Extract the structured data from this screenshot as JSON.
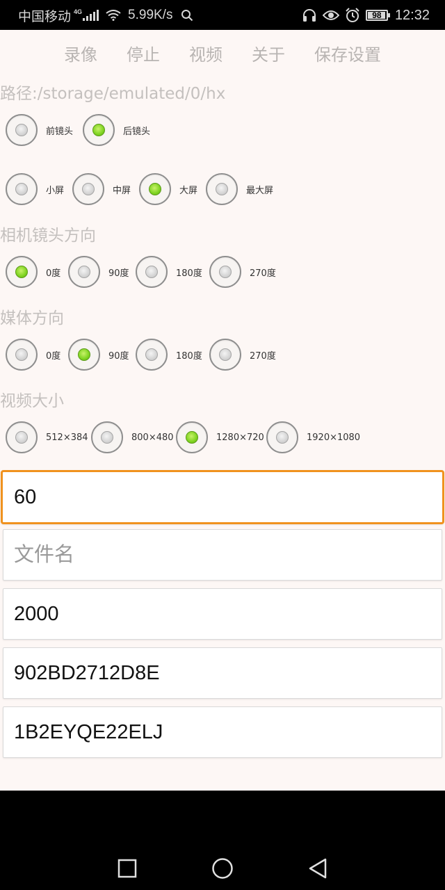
{
  "status_bar": {
    "carrier": "中国移动",
    "network_type": "4G",
    "speed": "5.99K/s",
    "battery_level": "98",
    "battery_fraction": 0.98,
    "time": "12:32"
  },
  "menu": {
    "items": [
      "录像",
      "停止",
      "视频",
      "关于",
      "保存设置"
    ]
  },
  "path_label": "路径:/storage/emulated/0/hx",
  "camera_group": {
    "options": [
      {
        "label": "前镜头",
        "checked": false
      },
      {
        "label": "后镜头",
        "checked": true
      }
    ]
  },
  "screen_group": {
    "options": [
      {
        "label": "小屏",
        "checked": false
      },
      {
        "label": "中屏",
        "checked": false
      },
      {
        "label": "大屏",
        "checked": true
      },
      {
        "label": "最大屏",
        "checked": false
      }
    ]
  },
  "lens_orientation": {
    "title": "相机镜头方向",
    "options": [
      {
        "label": "0度",
        "checked": true
      },
      {
        "label": "90度",
        "checked": false
      },
      {
        "label": "180度",
        "checked": false
      },
      {
        "label": "270度",
        "checked": false
      }
    ]
  },
  "media_orientation": {
    "title": "媒体方向",
    "options": [
      {
        "label": "0度",
        "checked": false
      },
      {
        "label": "90度",
        "checked": true
      },
      {
        "label": "180度",
        "checked": false
      },
      {
        "label": "270度",
        "checked": false
      }
    ]
  },
  "video_size": {
    "title": "视频大小",
    "options": [
      {
        "label": "512×384",
        "checked": false
      },
      {
        "label": "800×480",
        "checked": false
      },
      {
        "label": "1280×720",
        "checked": true
      },
      {
        "label": "1920×1080",
        "checked": false
      }
    ]
  },
  "fields": {
    "duration": {
      "value": "60",
      "placeholder": ""
    },
    "filename": {
      "value": "",
      "placeholder": "文件名"
    },
    "bitrate": {
      "value": "2000",
      "placeholder": ""
    },
    "device_id": {
      "value": "902BD2712D8E",
      "placeholder": ""
    },
    "key": {
      "value": "1B2EYQE22ELJ",
      "placeholder": ""
    }
  },
  "colors": {
    "accent_focus": "#f0921e",
    "radio_checked": "#7ed321",
    "background": "#fdf7f5"
  }
}
